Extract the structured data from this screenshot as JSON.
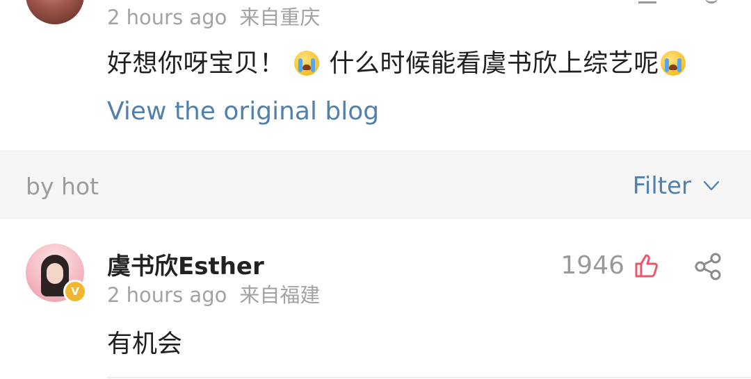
{
  "top_comment": {
    "time": "2 hours ago",
    "location": "来自重庆",
    "text_part1": "好想你呀宝贝！",
    "text_part2": "什么时候能看虞书欣上综艺呢",
    "emoji": "crying-face-icon",
    "view_original": "View the original blog"
  },
  "sort_bar": {
    "label": "by hot",
    "filter": "Filter"
  },
  "comment": {
    "author": "虞书欣Esther",
    "verified_badge": "V",
    "time": "2 hours ago",
    "location": "来自福建",
    "likes": "1946",
    "text": "有机会"
  },
  "colors": {
    "link": "#5080ad",
    "like_icon": "#e8566a",
    "badge": "#f2b630",
    "muted": "#a3a3a3"
  }
}
